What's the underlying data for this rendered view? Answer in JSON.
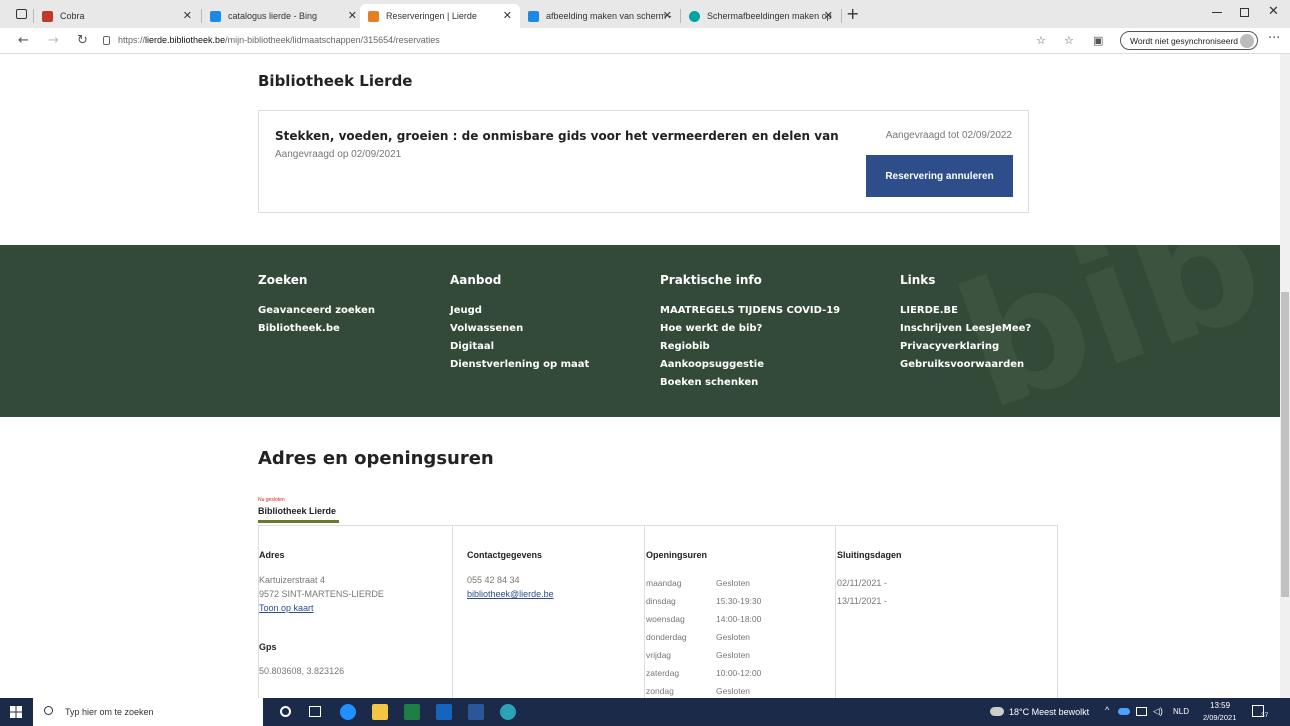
{
  "browser": {
    "tabs": [
      {
        "title": "Cobra",
        "fav": "#c0392b"
      },
      {
        "title": "catalogus lierde - Bing",
        "fav": "#1e88e5"
      },
      {
        "title": "Reserveringen | Lierde",
        "fav": "#e67e22"
      },
      {
        "title": "afbeelding maken van scherm - ",
        "fav": "#1e88e5"
      },
      {
        "title": "Schermafbeeldingen maken op ",
        "fav": "#00a3a3"
      }
    ],
    "url_prefix": "https://",
    "url_host": "lierde.bibliotheek.be",
    "url_path": "/mijn-bibliotheek/lidmaatschappen/315654/reservaties",
    "sync_label": "Wordt niet gesynchroniseerd"
  },
  "page": {
    "library_title": "Bibliotheek Lierde",
    "reservation": {
      "title": "Stekken, voeden, groeien : de onmisbare gids voor het vermeerderen en delen van",
      "requested_on": "Aangevraagd op 02/09/2021",
      "requested_until": "Aangevraagd tot 02/09/2022",
      "cancel_label": "Reservering annuleren"
    }
  },
  "footer": {
    "watermark": "bib",
    "columns": [
      {
        "heading": "Zoeken",
        "links": [
          "Geavanceerd zoeken",
          "Bibliotheek.be"
        ]
      },
      {
        "heading": "Aanbod",
        "links": [
          "Jeugd",
          "Volwassenen",
          "Digitaal",
          "Dienstverlening op maat"
        ]
      },
      {
        "heading": "Praktische info",
        "links": [
          "MAATREGELS TIJDENS COVID-19",
          "Hoe werkt de bib?",
          "Regiobib",
          "Aankoopsuggestie",
          "Boeken schenken"
        ]
      },
      {
        "heading": "Links",
        "links": [
          "LIERDE.BE",
          "Inschrijven LeesJeMee?",
          "Privacyverklaring",
          "Gebruiksvoorwaarden"
        ]
      }
    ]
  },
  "address_section": {
    "title": "Adres en openingsuren",
    "status": "Nu gesloten",
    "library_tab": "Bibliotheek Lierde",
    "adres": {
      "heading": "Adres",
      "street": "Kartuizerstraat 4",
      "city": "9572 SINT-MARTENS-LIERDE",
      "map_link": "Toon op kaart"
    },
    "gps": {
      "heading": "Gps",
      "value": "50.803608, 3.823126"
    },
    "contact": {
      "heading": "Contactgegevens",
      "phone": "055 42 84 34",
      "email": "bibliotheek@lierde.be"
    },
    "hours": {
      "heading": "Openingsuren",
      "rows": [
        {
          "day": "maandag",
          "time": "Gesloten"
        },
        {
          "day": "dinsdag",
          "time": "15:30-19:30"
        },
        {
          "day": "woensdag",
          "time": "14:00-18:00"
        },
        {
          "day": "donderdag",
          "time": "Gesloten"
        },
        {
          "day": "vrijdag",
          "time": "Gesloten"
        },
        {
          "day": "zaterdag",
          "time": "10:00-12:00"
        },
        {
          "day": "zondag",
          "time": "Gesloten"
        }
      ]
    },
    "closing": {
      "heading": "Sluitingsdagen",
      "dates": [
        "02/11/2021 -",
        "13/11/2021 -"
      ]
    }
  },
  "taskbar": {
    "search_placeholder": "Typ hier om te zoeken",
    "weather": "18°C Meest bewolkt",
    "lang": "NLD",
    "time": "13:59",
    "date": "2/09/2021",
    "notifications": "37"
  }
}
